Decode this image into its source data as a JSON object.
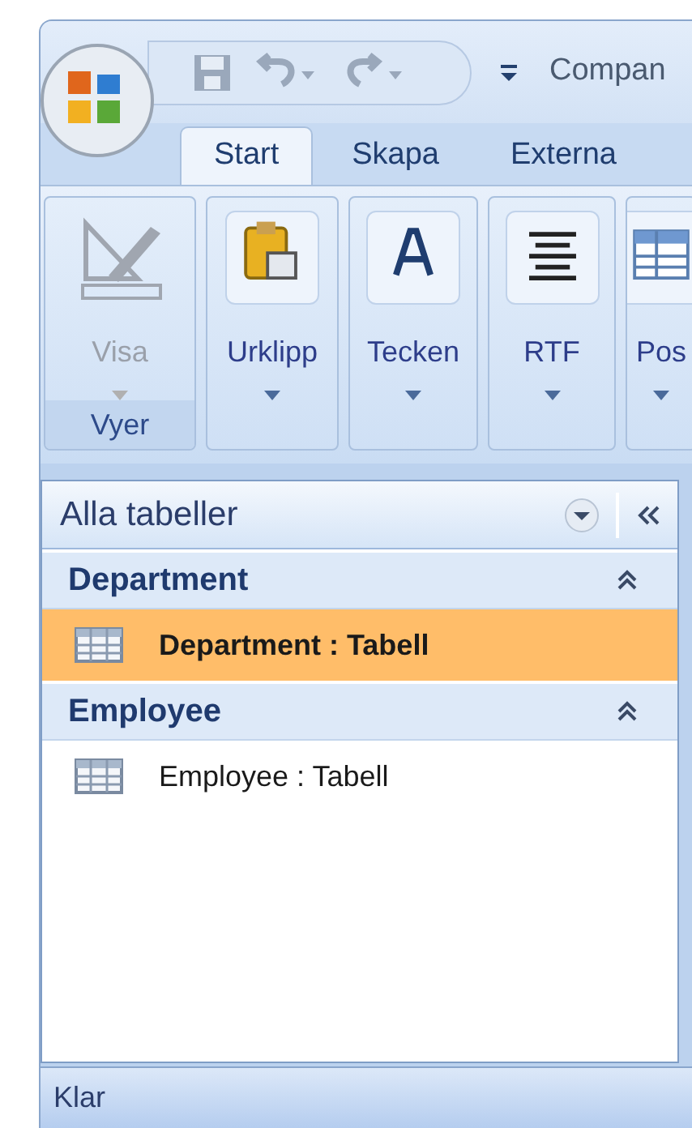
{
  "window": {
    "title": "Compan"
  },
  "quick_access": [
    {
      "kind": "save",
      "disabled": true
    },
    {
      "kind": "undo",
      "disabled": true
    },
    {
      "kind": "redo",
      "disabled": true
    }
  ],
  "tabs": [
    {
      "label": "Start",
      "selected": true
    },
    {
      "label": "Skapa",
      "selected": false
    },
    {
      "label": "Externa",
      "selected": false
    }
  ],
  "ribbon_groups": [
    {
      "label": "Vyer",
      "buttons": [
        {
          "label": "Visa",
          "kind": "view",
          "disabled": true
        }
      ]
    },
    {
      "buttons": [
        {
          "label": "Urklipp",
          "kind": "clipboard",
          "disabled": false
        }
      ]
    },
    {
      "buttons": [
        {
          "label": "Tecken",
          "kind": "font",
          "disabled": false
        }
      ]
    },
    {
      "buttons": [
        {
          "label": "RTF",
          "kind": "paragraph",
          "disabled": false
        }
      ]
    },
    {
      "buttons": [
        {
          "label": "Pos",
          "kind": "records",
          "disabled": false
        }
      ]
    }
  ],
  "navigation_pane": {
    "title": "Alla tabeller",
    "groups": [
      {
        "label": "Department",
        "expanded": true,
        "items": [
          {
            "label": "Department : Tabell",
            "selected": true
          }
        ]
      },
      {
        "label": "Employee",
        "expanded": true,
        "items": [
          {
            "label": "Employee : Tabell",
            "selected": false
          }
        ]
      }
    ]
  },
  "status_bar": {
    "text": "Klar"
  }
}
